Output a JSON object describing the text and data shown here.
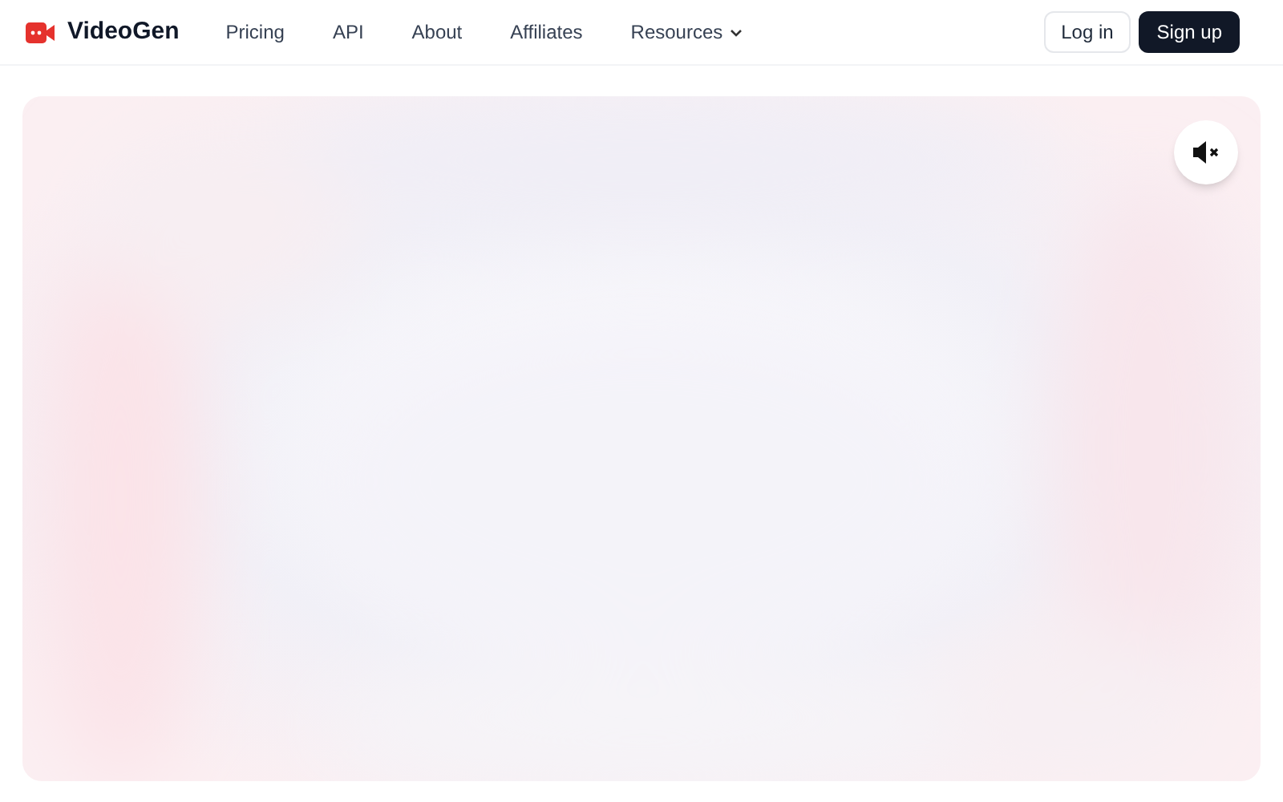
{
  "brand": {
    "name": "VideoGen"
  },
  "nav": [
    {
      "label": "Pricing",
      "kind": "link"
    },
    {
      "label": "API",
      "kind": "link"
    },
    {
      "label": "About",
      "kind": "link"
    },
    {
      "label": "Affiliates",
      "kind": "link"
    },
    {
      "label": "Resources",
      "kind": "dropdown"
    }
  ],
  "auth": [
    {
      "label": "Log in",
      "kind": "outline"
    },
    {
      "label": "Sign up",
      "kind": "solid"
    }
  ],
  "hero": {
    "kind": "picture",
    "muted": true
  }
}
